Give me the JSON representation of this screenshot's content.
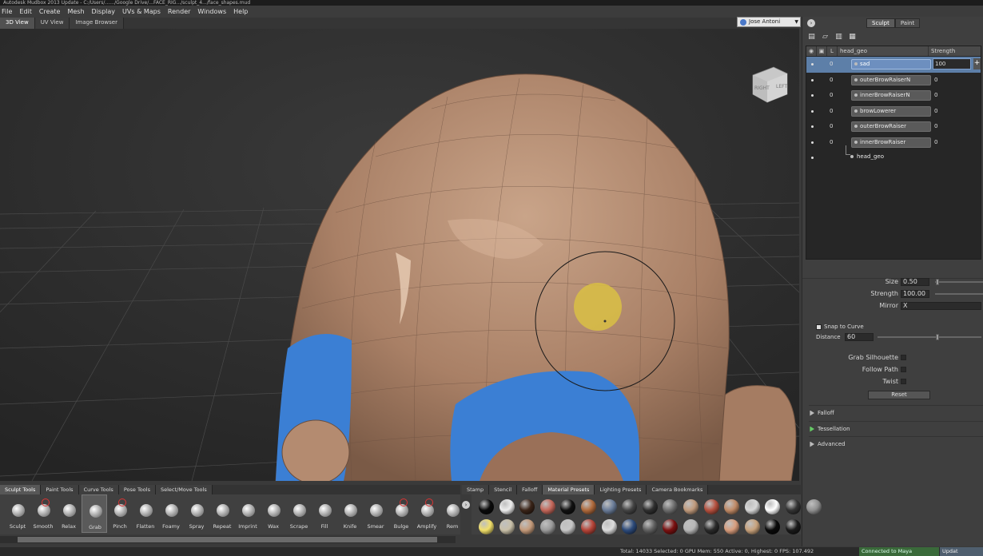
{
  "window": {
    "title": "Autodesk Mudbox 2013 Update - C:/Users/...…/Google Drive/...FACE_RIG.../sculpt_4.../face_shapes.mud"
  },
  "menu": [
    "File",
    "Edit",
    "Create",
    "Mesh",
    "Display",
    "UVs & Maps",
    "Render",
    "Windows",
    "Help"
  ],
  "view_tabs": [
    "3D View",
    "UV View",
    "Image Browser"
  ],
  "user": {
    "name": "Jose Antoni"
  },
  "viewcube": {
    "left": "RIGHT",
    "right": "LEFT"
  },
  "right_panel": {
    "mode_tabs": [
      "Sculpt",
      "Paint"
    ],
    "layer_headers": {
      "name": "head_geo",
      "strength": "Strength"
    },
    "layers": [
      {
        "name": "sad",
        "lock": "0",
        "strength": "100",
        "selected": true
      },
      {
        "name": "outerBrowRaiserN",
        "lock": "0",
        "strength": "0"
      },
      {
        "name": "innerBrowRaiserN",
        "lock": "0",
        "strength": "0"
      },
      {
        "name": "browLowerer",
        "lock": "0",
        "strength": "0"
      },
      {
        "name": "outerBrowRaiser",
        "lock": "0",
        "strength": "0"
      },
      {
        "name": "innerBrowRaiser",
        "lock": "0",
        "strength": "0"
      }
    ],
    "base_layer": "head_geo",
    "properties": {
      "size_label": "Size",
      "size_value": "0.50",
      "strength_label": "Strength",
      "strength_value": "100.00",
      "mirror_label": "Mirror",
      "mirror_value": "X",
      "snap_label": "Snap to Curve",
      "distance_label": "Distance",
      "distance_value": "60",
      "grab_silhouette": "Grab Silhouette",
      "follow_path": "Follow Path",
      "twist": "Twist",
      "reset": "Reset"
    },
    "sections": [
      "Falloff",
      "Tessellation",
      "Advanced"
    ]
  },
  "tray_tabs_left": [
    "Sculpt Tools",
    "Paint Tools",
    "Curve Tools",
    "Pose Tools",
    "Select/Move Tools"
  ],
  "tray_tabs_right": [
    "Stamp",
    "Stencil",
    "Falloff",
    "Material Presets",
    "Lighting Presets",
    "Camera Bookmarks"
  ],
  "brushes": [
    "Sculpt",
    "Smooth",
    "Relax",
    "Grab",
    "Pinch",
    "Flatten",
    "Foamy",
    "Spray",
    "Repeat",
    "Imprint",
    "Wax",
    "Scrape",
    "Fill",
    "Knife",
    "Smear",
    "Bulge",
    "Amplify",
    "Rem"
  ],
  "active_brush": "Grab",
  "materials_row1": [
    "#0a0a0a",
    "#eeeeee",
    "#3a2418",
    "#c4675a",
    "#111111",
    "#b06a3c",
    "#6a7c98",
    "#444444",
    "#2f2f2f",
    "#6d6d6d",
    "#c09a7c",
    "#b5503e",
    "#c08a66",
    "#d7d7d7",
    "#ffffff",
    "#333333",
    "#909090"
  ],
  "materials_row2": [
    "#f1df6a",
    "#c9c0a8",
    "#c49a7a",
    "#9a9a9a",
    "#c7c7c7",
    "#b64438",
    "#dcdcdc",
    "#2c4a7a",
    "#606060",
    "#7a1010",
    "#b8b8b8",
    "#2a2a2a",
    "#d79c7c",
    "#c8a27c",
    "#0a0a0a",
    "#1a1a1a"
  ],
  "status": {
    "text": "Total: 14033  Selected: 0  GPU Mem: 550  Active: 0, Highest: 0  FPS: 107.492",
    "maya": "Connected to Maya",
    "update": "Updat"
  }
}
